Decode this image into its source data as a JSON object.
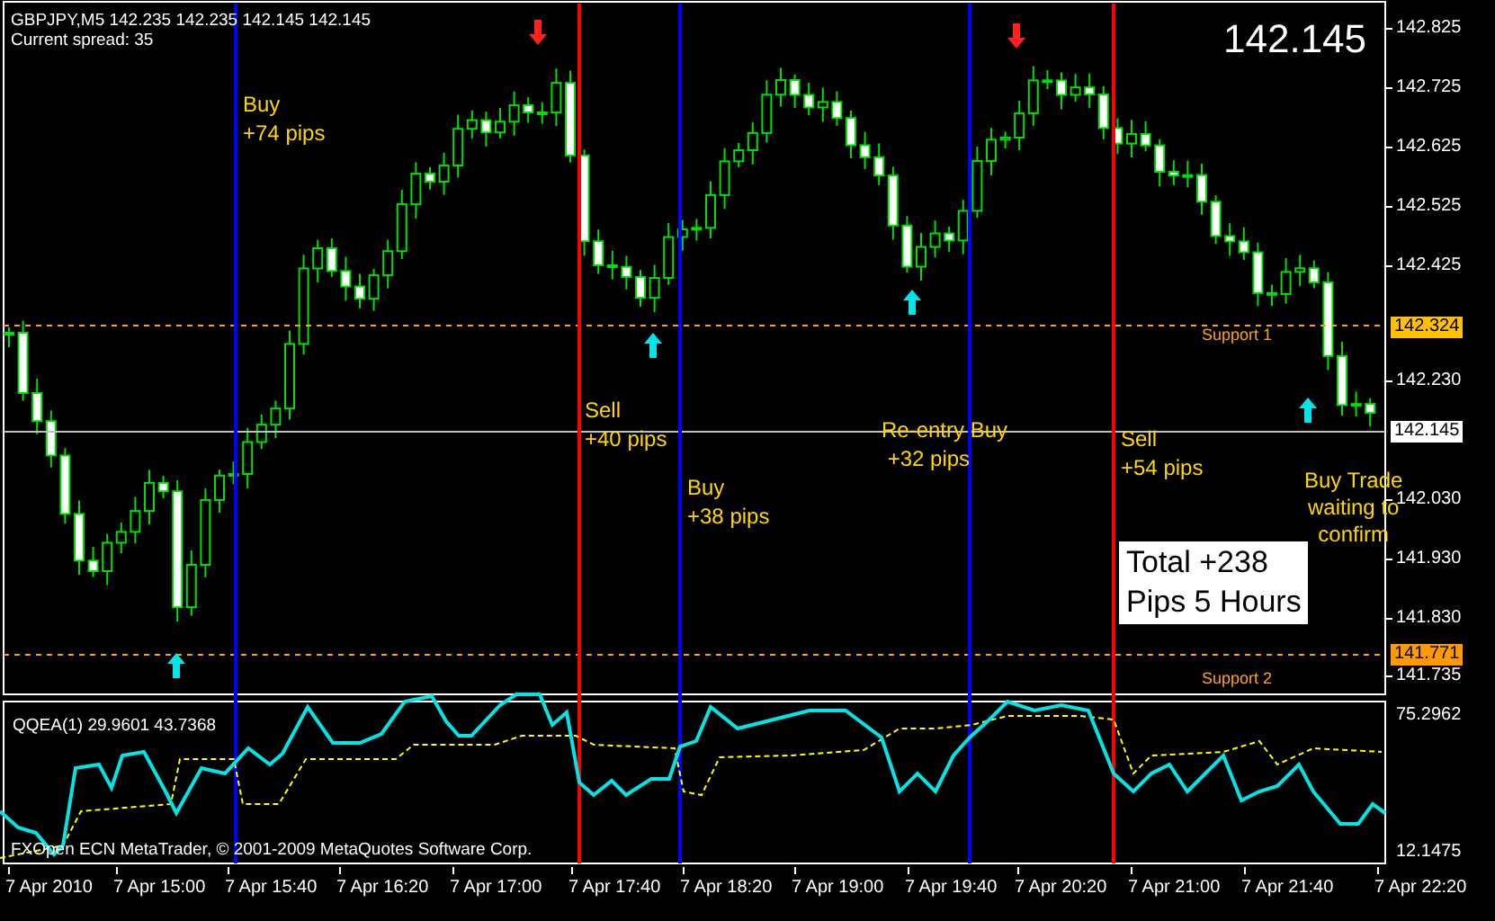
{
  "header": {
    "quote_line": "GBPJPY,M5  142.235 142.235 142.145 142.145",
    "spread": "Current spread: 35"
  },
  "big_price": "142.145",
  "price_axis": {
    "labels": [
      "142.825",
      "142.725",
      "142.625",
      "142.525",
      "142.425",
      "142.230",
      "142.030",
      "141.930",
      "141.830",
      "141.735"
    ]
  },
  "price_tags": [
    {
      "text": "142.324",
      "color": "#ffc000"
    },
    {
      "text": "142.145",
      "color": "#ffffff"
    },
    {
      "text": "141.771",
      "color": "#ff9900"
    }
  ],
  "horizontal_lines": [
    {
      "kind": "support",
      "label": "Support 1"
    },
    {
      "kind": "price"
    },
    {
      "kind": "support",
      "label": "Support 2"
    }
  ],
  "signal_lines": [
    {
      "color": "#0000ff"
    },
    {
      "color": "#ff0000"
    },
    {
      "color": "#0000ff"
    },
    {
      "color": "#0000ff"
    },
    {
      "color": "#ff0000"
    }
  ],
  "arrows": [
    {
      "kind": "up"
    },
    {
      "kind": "down"
    },
    {
      "kind": "up"
    },
    {
      "kind": "up"
    },
    {
      "kind": "down"
    },
    {
      "kind": "up"
    }
  ],
  "annotations": [
    {
      "lines": [
        "Buy",
        "+74 pips"
      ]
    },
    {
      "lines": [
        "Sell",
        "+40 pips"
      ]
    },
    {
      "lines": [
        "Buy",
        "+38 pips"
      ]
    },
    {
      "lines": [
        "Re-entry Buy",
        " +32 pips"
      ]
    },
    {
      "lines": [
        "Sell",
        "+54 pips"
      ]
    },
    {
      "lines": [
        "Buy Trade",
        "waiting to",
        "confirm"
      ]
    }
  ],
  "total_box": {
    "lines": [
      "Total +238",
      "Pips 5 Hours"
    ]
  },
  "indicator": {
    "label": "QQEA(1) 29.9601 43.7368",
    "axis_labels": [
      "75.2962",
      "12.1475"
    ],
    "copyright": "FXOpen ECN MetaTrader, © 2001-2009 MetaQuotes Software Corp."
  },
  "time_axis": {
    "labels": [
      "7 Apr 2010",
      "7 Apr 15:00",
      "7 Apr 15:40",
      "7 Apr 16:20",
      "7 Apr 17:00",
      "7 Apr 17:40",
      "7 Apr 18:20",
      "7 Apr 19:00",
      "7 Apr 19:40",
      "7 Apr 20:20",
      "7 Apr 21:00",
      "7 Apr 21:40",
      "7 Apr 22:20"
    ]
  }
}
